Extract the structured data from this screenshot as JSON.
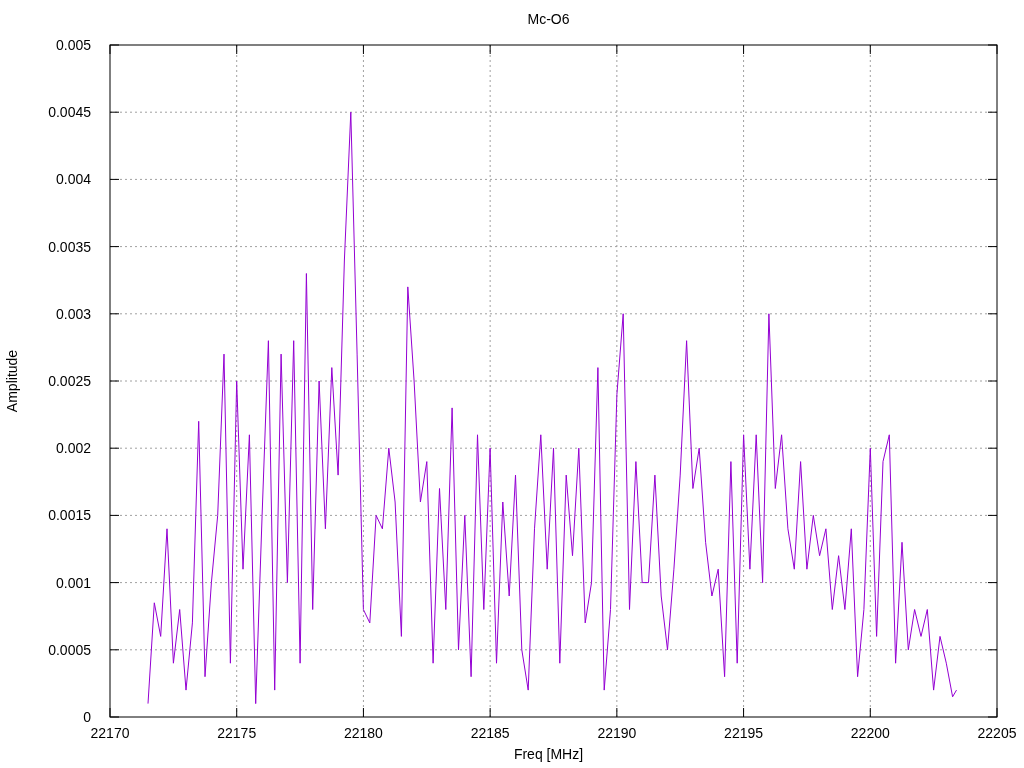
{
  "chart_data": {
    "type": "line",
    "grid": true,
    "title": "Mc-O6",
    "xlabel": "Freq [MHz]",
    "ylabel": "Amplitude",
    "xlim": [
      22170,
      22205
    ],
    "ylim": [
      0,
      0.005
    ],
    "xticks": [
      22170,
      22175,
      22180,
      22185,
      22190,
      22195,
      22200,
      22205
    ],
    "yticks": [
      0,
      0.0005,
      0.001,
      0.0015,
      0.002,
      0.0025,
      0.003,
      0.0035,
      0.004,
      0.0045,
      0.005
    ],
    "x": [
      22171.5,
      22171.75,
      22172,
      22172.25,
      22172.5,
      22172.75,
      22173,
      22173.25,
      22173.5,
      22173.75,
      22174,
      22174.25,
      22174.5,
      22174.75,
      22175,
      22175.25,
      22175.5,
      22175.75,
      22176,
      22176.25,
      22176.5,
      22176.75,
      22177,
      22177.25,
      22177.5,
      22177.75,
      22178,
      22178.25,
      22178.5,
      22178.75,
      22179,
      22179.25,
      22179.5,
      22179.75,
      22180,
      22180.25,
      22180.5,
      22180.75,
      22181,
      22181.25,
      22181.5,
      22181.75,
      22182,
      22182.25,
      22182.5,
      22182.75,
      22183,
      22183.25,
      22183.5,
      22183.75,
      22184,
      22184.25,
      22184.5,
      22184.75,
      22185,
      22185.25,
      22185.5,
      22185.75,
      22186,
      22186.25,
      22186.5,
      22186.75,
      22187,
      22187.25,
      22187.5,
      22187.75,
      22188,
      22188.25,
      22188.5,
      22188.75,
      22189,
      22189.25,
      22189.5,
      22189.75,
      22190,
      22190.25,
      22190.5,
      22190.75,
      22191,
      22191.25,
      22191.5,
      22191.75,
      22192,
      22192.25,
      22192.5,
      22192.75,
      22193,
      22193.25,
      22193.5,
      22193.75,
      22194,
      22194.25,
      22194.5,
      22194.75,
      22195,
      22195.25,
      22195.5,
      22195.75,
      22196,
      22196.25,
      22196.5,
      22196.75,
      22197,
      22197.25,
      22197.5,
      22197.75,
      22198,
      22198.25,
      22198.5,
      22198.75,
      22199,
      22199.25,
      22199.5,
      22199.75,
      22200,
      22200.25,
      22200.5,
      22200.75,
      22201,
      22201.25,
      22201.5,
      22201.75,
      22202,
      22202.25,
      22202.5,
      22202.75,
      22203,
      22203.25,
      22203.4
    ],
    "series": [
      {
        "color": "#9400d3",
        "values": [
          0.0001,
          0.00085,
          0.0006,
          0.0014,
          0.0004,
          0.0008,
          0.0002,
          0.0007,
          0.0022,
          0.0003,
          0.001,
          0.0015,
          0.0027,
          0.0004,
          0.0025,
          0.0011,
          0.0021,
          0.0001,
          0.0015,
          0.0028,
          0.0002,
          0.0027,
          0.001,
          0.0028,
          0.0004,
          0.0033,
          0.0008,
          0.0025,
          0.0014,
          0.0026,
          0.0018,
          0.0034,
          0.0045,
          0.0027,
          0.0008,
          0.0007,
          0.0015,
          0.0014,
          0.002,
          0.0016,
          0.0006,
          0.0032,
          0.0025,
          0.0016,
          0.0019,
          0.0004,
          0.0017,
          0.0008,
          0.0023,
          0.0005,
          0.0015,
          0.0003,
          0.0021,
          0.0008,
          0.002,
          0.0004,
          0.0016,
          0.0009,
          0.0018,
          0.0005,
          0.0002,
          0.0014,
          0.0021,
          0.0011,
          0.002,
          0.0004,
          0.0018,
          0.0012,
          0.002,
          0.0007,
          0.001,
          0.0026,
          0.0002,
          0.0008,
          0.0024,
          0.003,
          0.0008,
          0.0019,
          0.001,
          0.001,
          0.0018,
          0.0009,
          0.0005,
          0.0011,
          0.0018,
          0.0028,
          0.0017,
          0.002,
          0.0013,
          0.0009,
          0.0011,
          0.0003,
          0.0019,
          0.0004,
          0.0021,
          0.0011,
          0.0021,
          0.001,
          0.003,
          0.0017,
          0.0021,
          0.0014,
          0.0011,
          0.0019,
          0.0011,
          0.0015,
          0.0012,
          0.0014,
          0.0008,
          0.0012,
          0.0008,
          0.0014,
          0.0003,
          0.0008,
          0.002,
          0.0006,
          0.0019,
          0.0021,
          0.0004,
          0.0013,
          0.0005,
          0.0008,
          0.0006,
          0.0008,
          0.0002,
          0.0006,
          0.0004,
          0.00015,
          0.0002
        ]
      }
    ]
  }
}
